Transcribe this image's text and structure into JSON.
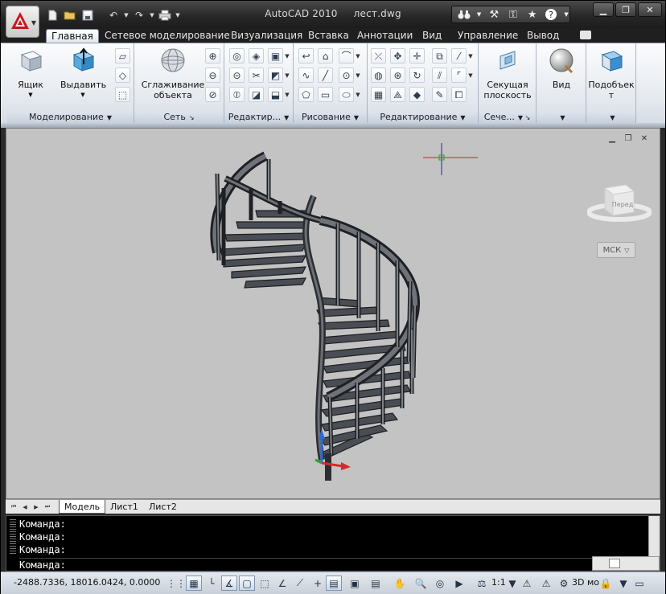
{
  "title": {
    "app": "AutoCAD 2010",
    "file": "лест.dwg"
  },
  "ribbon_tabs": [
    {
      "label": "Главная",
      "active": true
    },
    {
      "label": "Сетевое моделирование"
    },
    {
      "label": "Визуализация"
    },
    {
      "label": "Вставка"
    },
    {
      "label": "Аннотации"
    },
    {
      "label": "Вид"
    },
    {
      "label": "Управление"
    },
    {
      "label": "Вывод"
    }
  ],
  "ribbon": {
    "box_label": "Ящик",
    "extrude_label": "Выдавить",
    "smooth_label_1": "Сглаживание",
    "smooth_label_2": "объекта",
    "section_label_1": "Секущая",
    "section_label_2": "плоскость",
    "view_label": "Вид",
    "subobj_label_1": "Подобъек",
    "subobj_label_2": "т",
    "panels": {
      "modeling": "Моделирование",
      "mesh": "Сеть",
      "edit": "Редактир...",
      "draw": "Рисование",
      "modify": "Редактирование",
      "section": "Сече..."
    }
  },
  "viewport": {
    "viewcube_face": "Перед",
    "ucs_label": "МСК"
  },
  "layout_tabs": [
    "Модель",
    "Лист1",
    "Лист2"
  ],
  "command": {
    "history": [
      "Команда:",
      "Команда:",
      "Команда:"
    ],
    "prompt": "Команда:"
  },
  "status": {
    "coords": "-2488.7336, 18016.0424, 0.0000",
    "scale": "1:1",
    "workspace": "3D мо"
  },
  "colors": {
    "accent_red": "#c8161d",
    "ribbon_bg": "#e5e9ef",
    "viewport_bg": "#c3c3c3"
  }
}
